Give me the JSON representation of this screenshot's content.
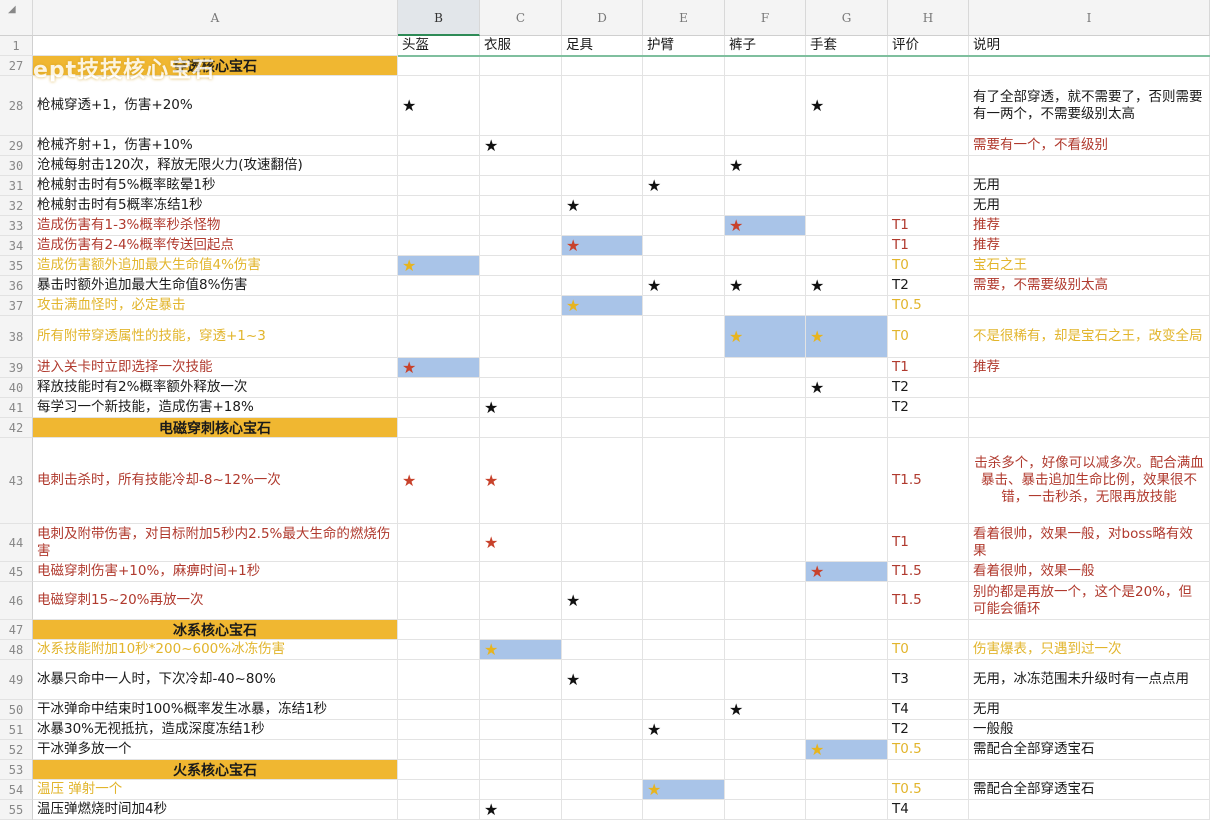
{
  "sheet": {
    "corner_glyph": "◢",
    "columns": [
      {
        "letter": "A",
        "header": ""
      },
      {
        "letter": "B",
        "header": "头盔"
      },
      {
        "letter": "C",
        "header": "衣服"
      },
      {
        "letter": "D",
        "header": "足具"
      },
      {
        "letter": "E",
        "header": "护臂"
      },
      {
        "letter": "F",
        "header": "裤子"
      },
      {
        "letter": "G",
        "header": "手套"
      },
      {
        "letter": "H",
        "header": "评价"
      },
      {
        "letter": "I",
        "header": "说明"
      }
    ],
    "selected_column": "B",
    "overlay_title": "ept技技核心宝石",
    "rows": [
      {
        "num": "1",
        "type": "header"
      },
      {
        "num": "27",
        "type": "section",
        "text": "穿透核心宝石"
      },
      {
        "num": "28",
        "text": "枪械穿透+1，伤害+20%",
        "color": "dark",
        "stars": [
          {
            "col": "B",
            "color": "black"
          },
          {
            "col": "G",
            "color": "black"
          }
        ],
        "tier": "",
        "note": "有了全部穿透，就不需要了，否则需要有一两个，不需要级别太高",
        "note_color": "dark"
      },
      {
        "num": "29",
        "text": "枪械齐射+1，伤害+10%",
        "color": "dark",
        "stars": [
          {
            "col": "C",
            "color": "black"
          }
        ],
        "tier": "",
        "note": "需要有一个，不看级别",
        "note_color": "red"
      },
      {
        "num": "30",
        "text": "沧械每射击120次，释放无限火力(攻速翻倍)",
        "color": "dark",
        "stars": [
          {
            "col": "F",
            "color": "black"
          }
        ],
        "tier": "",
        "note": "",
        "note_color": "dark"
      },
      {
        "num": "31",
        "text": "枪械射击时有5%概率眩晕1秒",
        "color": "dark",
        "stars": [
          {
            "col": "E",
            "color": "black"
          }
        ],
        "tier": "",
        "note": "无用",
        "note_color": "dark"
      },
      {
        "num": "32",
        "text": "枪械射击时有5概率冻结1秒",
        "color": "dark",
        "stars": [
          {
            "col": "D",
            "color": "black"
          }
        ],
        "tier": "",
        "note": "无用",
        "note_color": "dark"
      },
      {
        "num": "33",
        "text": "造成伤害有1-3%概率秒杀怪物",
        "color": "red",
        "stars": [
          {
            "col": "F",
            "color": "red",
            "hl": true
          }
        ],
        "tier": "T1",
        "note": "推荐",
        "note_color": "red"
      },
      {
        "num": "34",
        "text": "造成伤害有2-4%概率传送回起点",
        "color": "red",
        "stars": [
          {
            "col": "D",
            "color": "red",
            "hl": true
          }
        ],
        "tier": "T1",
        "note": "推荐",
        "note_color": "red"
      },
      {
        "num": "35",
        "text": "造成伤害额外追加最大生命值4%伤害",
        "color": "gold",
        "stars": [
          {
            "col": "B",
            "color": "gold",
            "hl": true
          }
        ],
        "tier": "T0",
        "note": "宝石之王",
        "note_color": "gold"
      },
      {
        "num": "36",
        "text": "暴击时额外追加最大生命值8%伤害",
        "color": "dark",
        "stars": [
          {
            "col": "E",
            "color": "black"
          },
          {
            "col": "F",
            "color": "black"
          },
          {
            "col": "G",
            "color": "black"
          }
        ],
        "tier": "T2",
        "note": "需要，不需要级别太高",
        "note_color": "red"
      },
      {
        "num": "37",
        "text": "攻击满血怪时，必定暴击",
        "color": "gold",
        "stars": [
          {
            "col": "D",
            "color": "gold",
            "hl": true
          }
        ],
        "tier": "T0.5",
        "note": "",
        "note_color": "dark"
      },
      {
        "num": "38",
        "text": "所有附带穿透属性的技能，穿透+1~3",
        "color": "gold",
        "stars": [
          {
            "col": "F",
            "color": "gold",
            "hl": true
          },
          {
            "col": "G",
            "color": "gold",
            "hl": true
          }
        ],
        "tier": "T0",
        "note": "不是很稀有，却是宝石之王，改变全局",
        "note_color": "gold"
      },
      {
        "num": "39",
        "text": "进入关卡时立即选择一次技能",
        "color": "red",
        "stars": [
          {
            "col": "B",
            "color": "red",
            "hl": true
          }
        ],
        "tier": "T1",
        "note": "推荐",
        "note_color": "red"
      },
      {
        "num": "40",
        "text": "释放技能时有2%概率额外释放一次",
        "color": "dark",
        "stars": [
          {
            "col": "G",
            "color": "black"
          }
        ],
        "tier": "T2",
        "note": "",
        "note_color": "dark"
      },
      {
        "num": "41",
        "text": "每学习一个新技能，造成伤害+18%",
        "color": "dark",
        "stars": [
          {
            "col": "C",
            "color": "black"
          }
        ],
        "tier": "T2",
        "note": "",
        "note_color": "dark"
      },
      {
        "num": "42",
        "type": "section",
        "text": "电磁穿刺核心宝石"
      },
      {
        "num": "43",
        "text": "电刺击杀时，所有技能冷却-8~12%一次",
        "color": "red",
        "stars": [
          {
            "col": "B",
            "color": "red"
          },
          {
            "col": "C",
            "color": "red"
          }
        ],
        "tier": "T1.5",
        "note": "击杀多个，好像可以减多次。配合满血暴击、暴击追加生命比例，效果很不错，一击秒杀，无限再放技能",
        "note_color": "red",
        "note_center": true
      },
      {
        "num": "44",
        "text": "电刺及附带伤害，对目标附加5秒内2.5%最大生命的燃烧伤害",
        "color": "red",
        "stars": [
          {
            "col": "C",
            "color": "red"
          }
        ],
        "tier": "T1",
        "note": "看着很帅，效果一般，对boss略有效果",
        "note_color": "red"
      },
      {
        "num": "45",
        "text": "电磁穿刺伤害+10%，麻痹时间+1秒",
        "color": "red",
        "stars": [
          {
            "col": "G",
            "color": "red",
            "hl": true
          }
        ],
        "tier": "T1.5",
        "note": "看着很帅，效果一般",
        "note_color": "red"
      },
      {
        "num": "46",
        "text": "电磁穿刺15~20%再放一次",
        "color": "red",
        "stars": [
          {
            "col": "D",
            "color": "black"
          }
        ],
        "tier": "T1.5",
        "note": "别的都是再放一个，这个是20%，但可能会循环",
        "note_color": "red"
      },
      {
        "num": "47",
        "type": "section",
        "text": "冰系核心宝石"
      },
      {
        "num": "48",
        "text": "冰系技能附加10秒*200~600%冰冻伤害",
        "color": "gold",
        "stars": [
          {
            "col": "C",
            "color": "gold",
            "hl": true
          }
        ],
        "tier": "T0",
        "note": "伤害爆表，只遇到过一次",
        "note_color": "gold"
      },
      {
        "num": "49",
        "text": "冰暴只命中一人时，下次冷却-40~80%",
        "color": "dark",
        "stars": [
          {
            "col": "D",
            "color": "black"
          }
        ],
        "tier": "T3",
        "note": "无用，冰冻范围未升级时有一点点用",
        "note_color": "dark"
      },
      {
        "num": "50",
        "text": "干冰弹命中结束时100%概率发生冰暴，冻结1秒",
        "color": "dark",
        "stars": [
          {
            "col": "F",
            "color": "black"
          }
        ],
        "tier": "T4",
        "note": "无用",
        "note_color": "dark"
      },
      {
        "num": "51",
        "text": "冰暴30%无视抵抗，造成深度冻结1秒",
        "color": "dark",
        "stars": [
          {
            "col": "E",
            "color": "black"
          }
        ],
        "tier": "T2",
        "note": "一般般",
        "note_color": "dark"
      },
      {
        "num": "52",
        "text": "干冰弹多放一个",
        "color": "dark",
        "stars": [
          {
            "col": "G",
            "color": "gold",
            "hl": true
          }
        ],
        "tier": "T0.5",
        "tier_color": "gold",
        "note": "需配合全部穿透宝石",
        "note_color": "dark"
      },
      {
        "num": "53",
        "type": "section",
        "text": "火系核心宝石"
      },
      {
        "num": "54",
        "text": "温压 弹射一个",
        "color": "gold",
        "stars": [
          {
            "col": "E",
            "color": "gold",
            "hl": true
          }
        ],
        "tier": "T0.5",
        "note": "需配合全部穿透宝石",
        "note_color": "dark"
      },
      {
        "num": "55",
        "text": "温压弹燃烧时间加4秒",
        "color": "dark",
        "stars": [
          {
            "col": "C",
            "color": "black"
          }
        ],
        "tier": "T4",
        "note": "",
        "note_color": "dark"
      }
    ]
  }
}
